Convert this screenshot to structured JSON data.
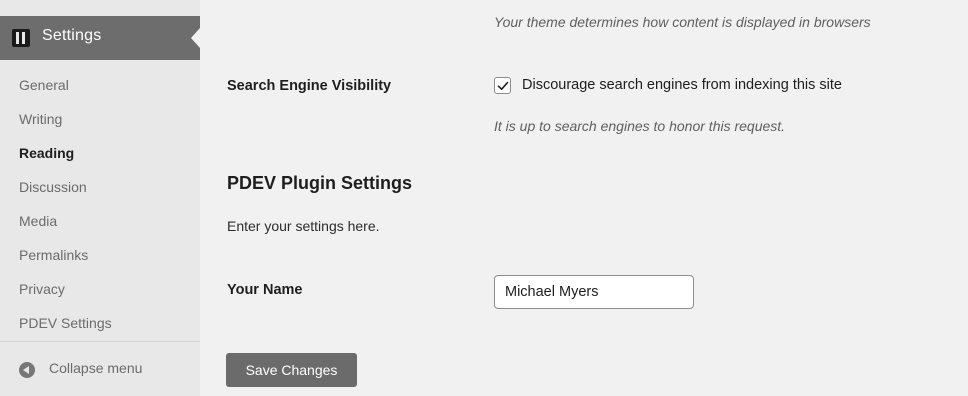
{
  "sidebar": {
    "header": {
      "label": "Settings",
      "icon": "settings-icon"
    },
    "items": [
      {
        "label": "General"
      },
      {
        "label": "Writing"
      },
      {
        "label": "Reading",
        "current": true
      },
      {
        "label": "Discussion"
      },
      {
        "label": "Media"
      },
      {
        "label": "Permalinks"
      },
      {
        "label": "Privacy"
      },
      {
        "label": "PDEV Settings"
      }
    ],
    "collapse": {
      "label": "Collapse menu",
      "icon": "collapse-icon"
    }
  },
  "main": {
    "theme_note": "Your theme determines how content is displayed in browsers",
    "search_visibility": {
      "label": "Search Engine Visibility",
      "checkbox_label": "Discourage search engines from indexing this site",
      "checked": true,
      "note": "It is up to search engines to honor this request."
    },
    "plugin_section": {
      "heading": "PDEV Plugin Settings",
      "description": "Enter your settings here.",
      "name_label": "Your Name",
      "name_value": "Michael Myers"
    },
    "save_button": "Save Changes"
  }
}
